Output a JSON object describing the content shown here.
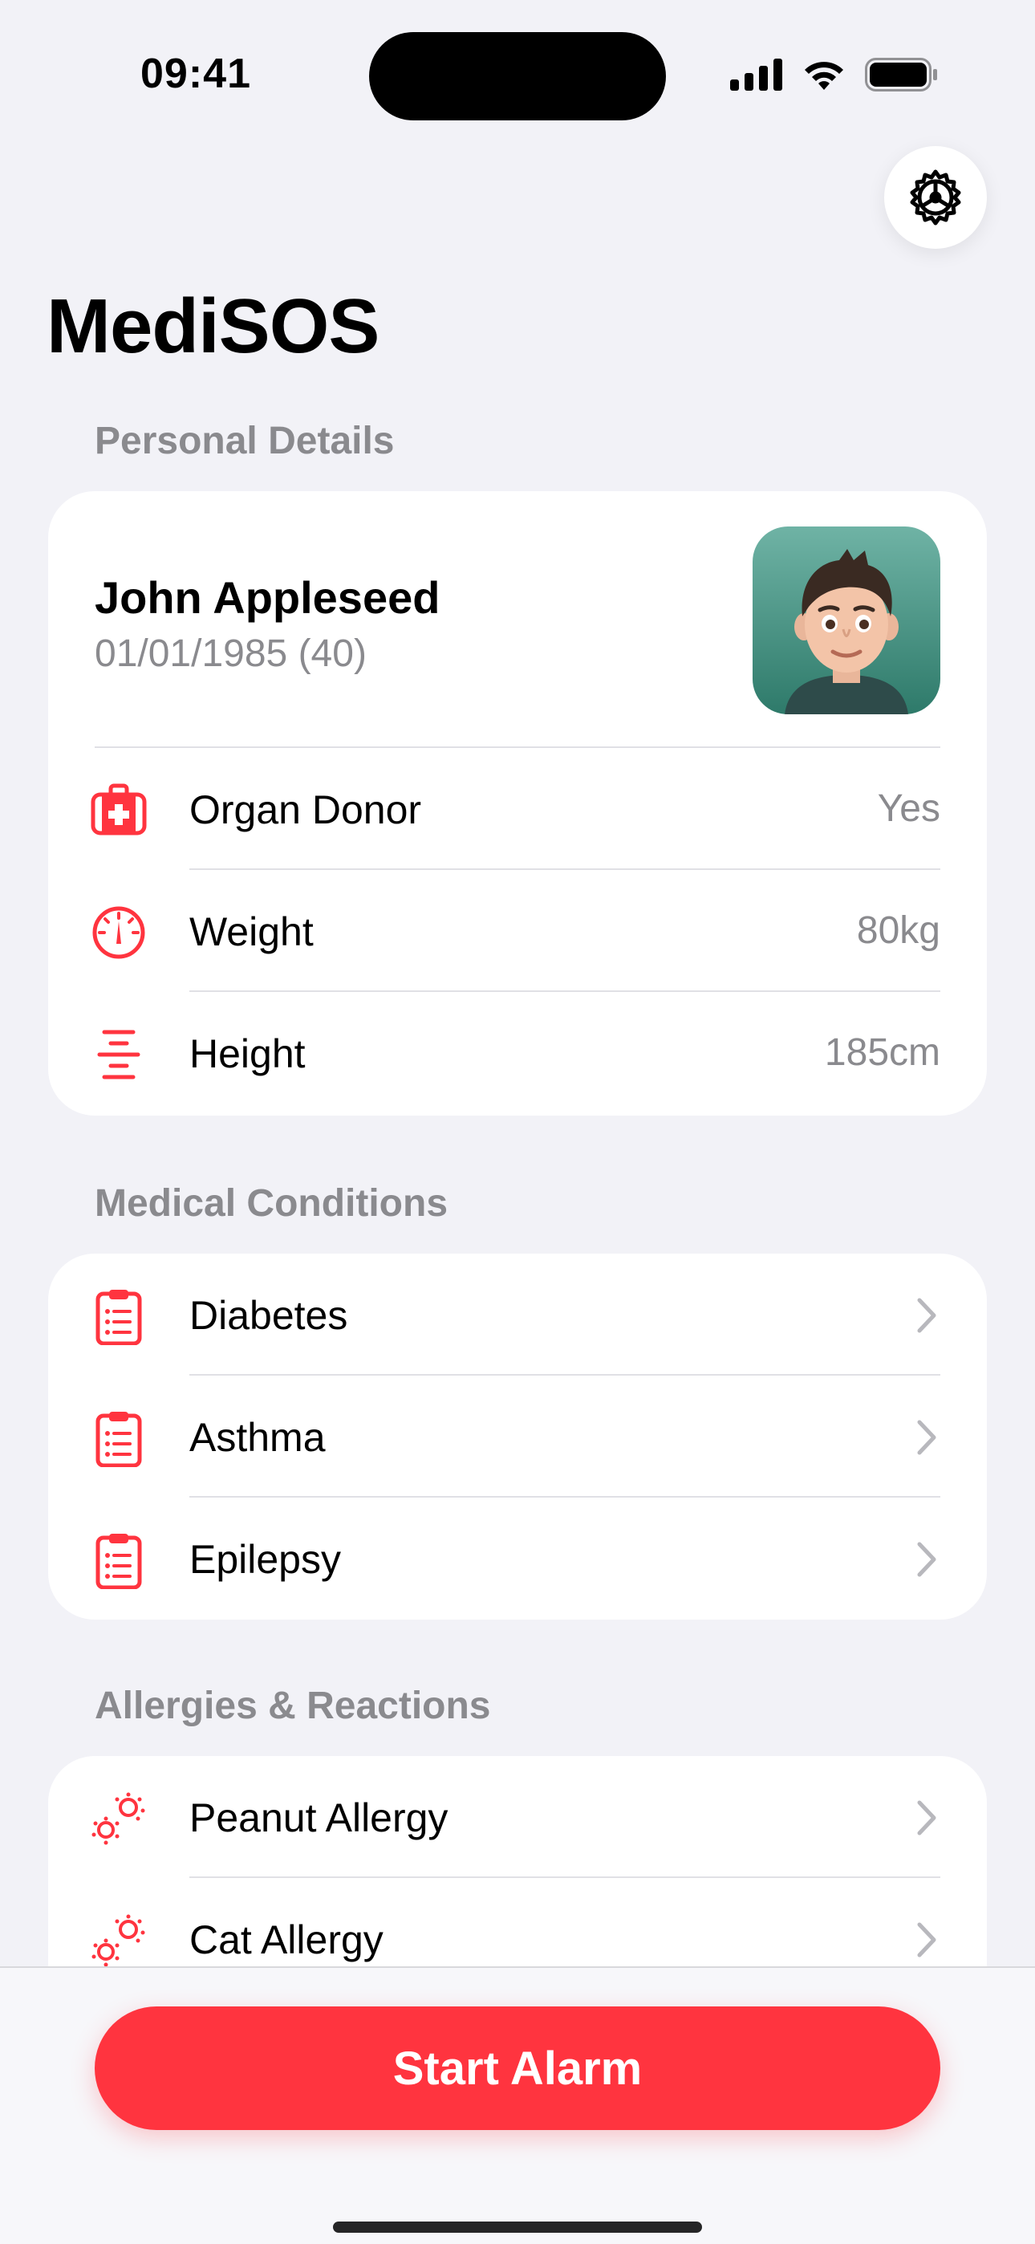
{
  "status_bar": {
    "time": "09:41"
  },
  "app": {
    "title": "MediSOS"
  },
  "personal": {
    "header": "Personal Details",
    "name": "John Appleseed",
    "dob": "01/01/1985 (40)",
    "rows": [
      {
        "label": "Organ Donor",
        "value": "Yes",
        "icon": "medical-kit-icon"
      },
      {
        "label": "Weight",
        "value": "80kg",
        "icon": "gauge-icon"
      },
      {
        "label": "Height",
        "value": "185cm",
        "icon": "height-icon"
      }
    ]
  },
  "conditions": {
    "header": "Medical Conditions",
    "items": [
      {
        "label": "Diabetes",
        "icon": "clipboard-list-icon"
      },
      {
        "label": "Asthma",
        "icon": "clipboard-list-icon"
      },
      {
        "label": "Epilepsy",
        "icon": "clipboard-list-icon"
      }
    ]
  },
  "allergies": {
    "header": "Allergies & Reactions",
    "items": [
      {
        "label": "Peanut Allergy",
        "icon": "allergens-icon"
      },
      {
        "label": "Cat Allergy",
        "icon": "allergens-icon"
      }
    ]
  },
  "actions": {
    "alarm_label": "Start Alarm"
  },
  "colors": {
    "accent": "#FF343F",
    "background": "#F2F2F7",
    "secondary_text": "#8A8A8E"
  }
}
